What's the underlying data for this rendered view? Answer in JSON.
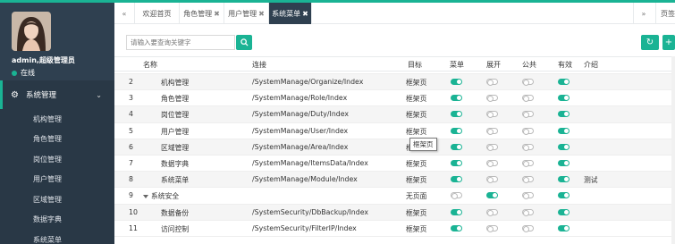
{
  "user": {
    "name": "admin,超级管理员",
    "status": "在线"
  },
  "sidebar": {
    "group_label": "系统管理",
    "items": [
      {
        "label": "机构管理"
      },
      {
        "label": "角色管理"
      },
      {
        "label": "岗位管理"
      },
      {
        "label": "用户管理"
      },
      {
        "label": "区域管理"
      },
      {
        "label": "数据字典"
      },
      {
        "label": "系统菜单"
      }
    ]
  },
  "tabs": [
    {
      "label": "欢迎首页",
      "closable": false,
      "active": false
    },
    {
      "label": "角色管理",
      "closable": true,
      "active": false
    },
    {
      "label": "用户管理",
      "closable": true,
      "active": false
    },
    {
      "label": "系统菜单",
      "closable": true,
      "active": true
    }
  ],
  "tab_more_label": "页签",
  "search": {
    "placeholder": "请输入要查询关键字"
  },
  "columns": [
    "名称",
    "连接",
    "目标",
    "菜单",
    "展开",
    "公共",
    "有效",
    "介绍"
  ],
  "rows": [
    {
      "no": "2",
      "name": "机构管理",
      "url": "/SystemManage/Organize/Index",
      "target": "框架页",
      "menu": true,
      "expand": false,
      "public": false,
      "valid": true,
      "note": ""
    },
    {
      "no": "3",
      "name": "角色管理",
      "url": "/SystemManage/Role/Index",
      "target": "框架页",
      "menu": true,
      "expand": false,
      "public": false,
      "valid": true,
      "note": ""
    },
    {
      "no": "4",
      "name": "岗位管理",
      "url": "/SystemManage/Duty/Index",
      "target": "框架页",
      "menu": true,
      "expand": false,
      "public": false,
      "valid": true,
      "note": ""
    },
    {
      "no": "5",
      "name": "用户管理",
      "url": "/SystemManage/User/Index",
      "target": "框架页",
      "menu": true,
      "expand": false,
      "public": false,
      "valid": true,
      "note": ""
    },
    {
      "no": "6",
      "name": "区域管理",
      "url": "/SystemManage/Area/Index",
      "target": "框架页",
      "menu": true,
      "expand": false,
      "public": false,
      "valid": true,
      "note": ""
    },
    {
      "no": "7",
      "name": "数据字典",
      "url": "/SystemManage/ItemsData/Index",
      "target": "框架页",
      "menu": true,
      "expand": false,
      "public": false,
      "valid": true,
      "note": ""
    },
    {
      "no": "8",
      "name": "系统菜单",
      "url": "/SystemManage/Module/Index",
      "target": "框架页",
      "menu": true,
      "expand": false,
      "public": false,
      "valid": true,
      "note": "测试"
    },
    {
      "no": "9",
      "name": "系统安全",
      "url": "",
      "target": "无页面",
      "menu": false,
      "expand": true,
      "public": false,
      "valid": true,
      "note": "",
      "group": true
    },
    {
      "no": "10",
      "name": "数据备份",
      "url": "/SystemSecurity/DbBackup/Index",
      "target": "框架页",
      "menu": true,
      "expand": false,
      "public": false,
      "valid": true,
      "note": ""
    },
    {
      "no": "11",
      "name": "访问控制",
      "url": "/SystemSecurity/FilterIP/Index",
      "target": "框架页",
      "menu": true,
      "expand": false,
      "public": false,
      "valid": true,
      "note": ""
    }
  ],
  "tooltip": "框架页",
  "colors": {
    "accent": "#1ab394",
    "sidebar": "#2f4050"
  }
}
